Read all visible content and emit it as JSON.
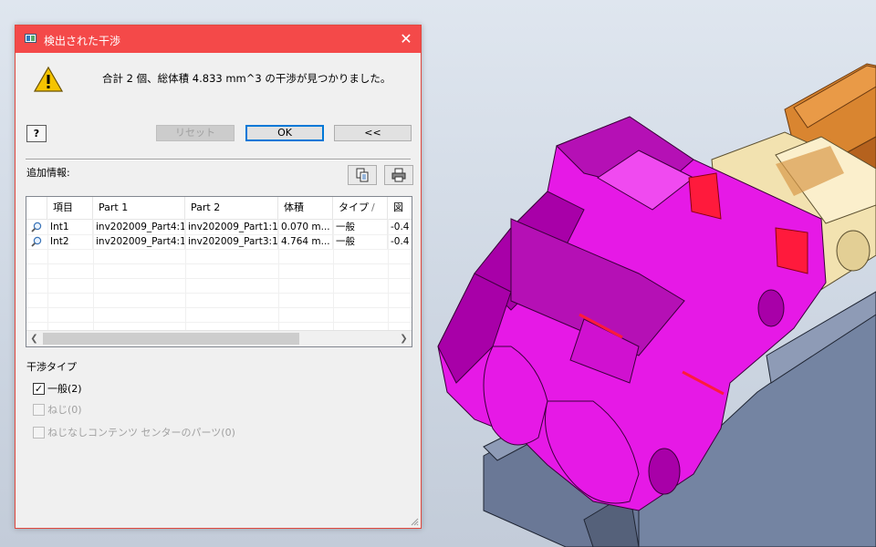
{
  "dialog": {
    "title": "検出された干渉",
    "close_glyph": "✕",
    "message": "合計 2 個、総体積 4.833 mm^3 の干渉が見つかりました。",
    "help_label": "?",
    "reset_label": "リセット",
    "ok_label": "OK",
    "collapse_label": "<<",
    "additional_info_label": "追加情報:",
    "copy_icon": "copy-icon",
    "print_icon": "printer-icon",
    "table": {
      "columns": [
        "項目",
        "Part 1",
        "Part 2",
        "体積",
        "タイプ",
        "図"
      ],
      "sort_indicator": "/",
      "rows": [
        {
          "item": "Int1",
          "part1": "inv202009_Part4:1",
          "part2": "inv202009_Part1:1",
          "volume": "0.070 m...",
          "type": "一般",
          "fig": "-0.4"
        },
        {
          "item": "Int2",
          "part1": "inv202009_Part4:1",
          "part2": "inv202009_Part3:1",
          "volume": "4.764 m...",
          "type": "一般",
          "fig": "-0.4"
        }
      ]
    },
    "interference_type_label": "干渉タイプ",
    "checks": [
      {
        "label": "一般(2)",
        "checked": true,
        "enabled": true
      },
      {
        "label": "ねじ(0)",
        "checked": false,
        "enabled": false
      },
      {
        "label": "ねじなしコンテンツ センターのパーツ(0)",
        "checked": false,
        "enabled": false
      }
    ]
  },
  "colors": {
    "titlebar": "#f44949",
    "dialog_bg": "#f0f0f0",
    "part_magenta": "#e619e6",
    "part_dark_magenta": "#a800a8",
    "interference_red": "#ff1a3c",
    "base_blue_gray": "#6a7896",
    "tan_part": "#f2e2b0",
    "orange_part": "#d2772a"
  }
}
